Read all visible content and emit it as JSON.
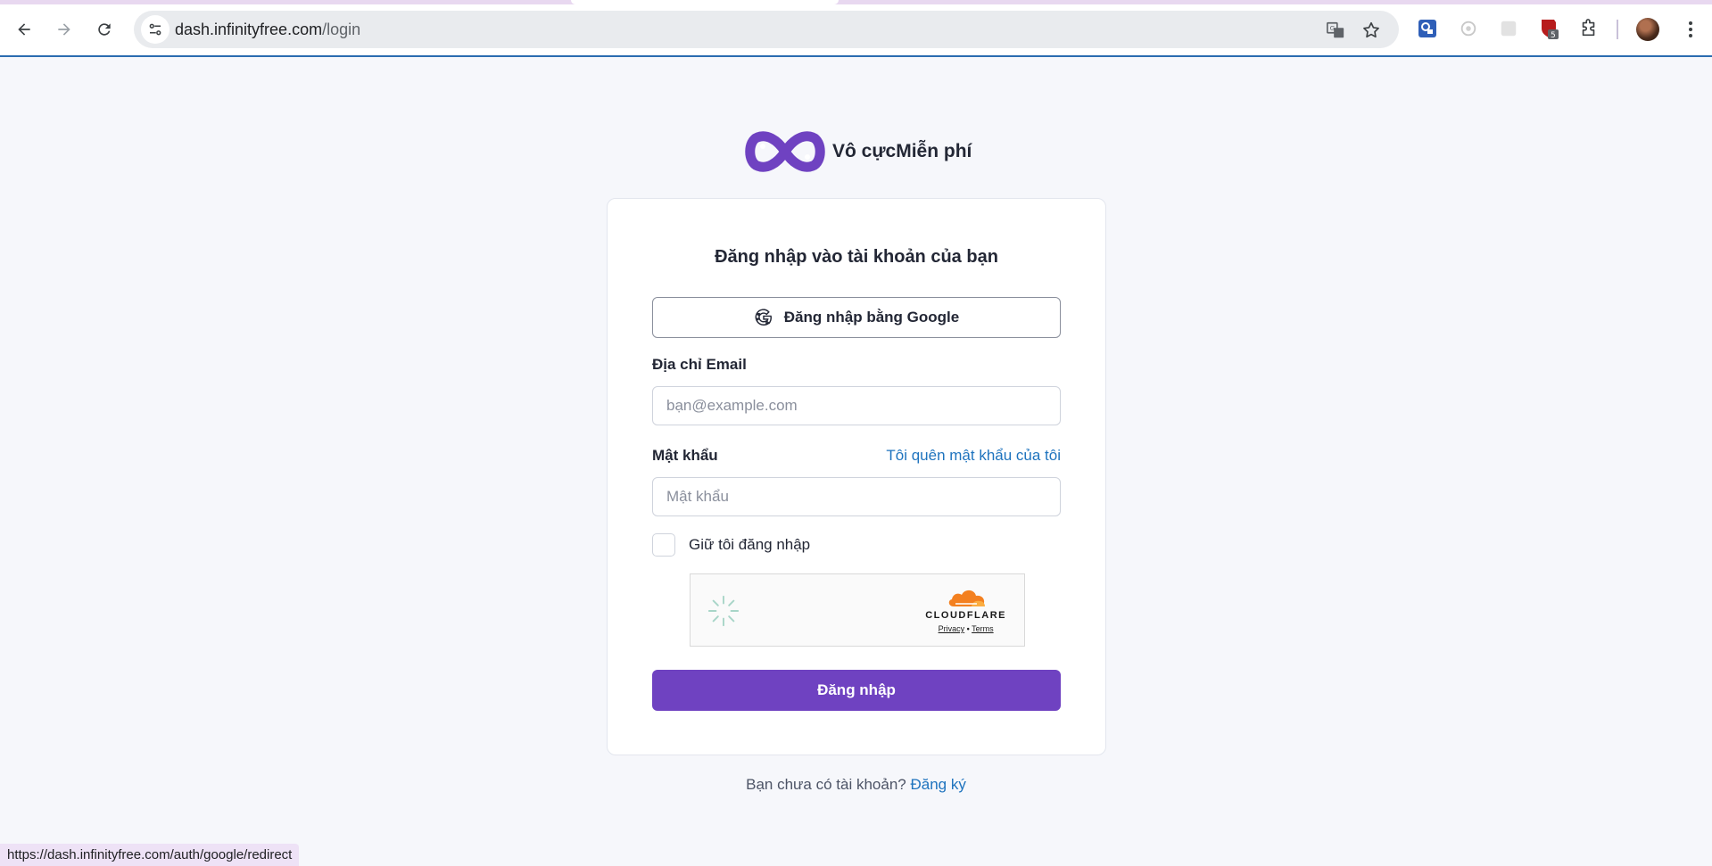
{
  "browser": {
    "url_domain": "dash.infinityfree.com",
    "url_path": "/login",
    "extension_badge": "5",
    "icons": [
      "back-arrow-icon",
      "forward-arrow-icon",
      "reload-icon",
      "site-info-icon",
      "translate-icon",
      "bookmark-star-icon",
      "extensions-puzzle-icon",
      "kebab-menu-icon"
    ],
    "status_url": "https://dash.infinityfree.com/auth/google/redirect"
  },
  "brand": {
    "name": "Vô cựcMiễn phí",
    "logo_color": "#6f42c1"
  },
  "login": {
    "title": "Đăng nhập vào tài khoản của bạn",
    "google_button": "Đăng nhập bằng Google",
    "email_label": "Địa chỉ Email",
    "email_placeholder": "bạn@example.com",
    "password_label": "Mật khẩu",
    "forgot_link": "Tôi quên mật khẩu của tôi",
    "password_placeholder": "Mật khẩu",
    "remember_label": "Giữ tôi đăng nhập",
    "submit_label": "Đăng nhập",
    "accent": "#6f42c1"
  },
  "captcha": {
    "provider": "CLOUDFLARE",
    "privacy": "Privacy",
    "separator": "•",
    "terms": "Terms"
  },
  "signup": {
    "prompt": "Bạn chưa có tài khoản?",
    "link": "Đăng ký"
  }
}
